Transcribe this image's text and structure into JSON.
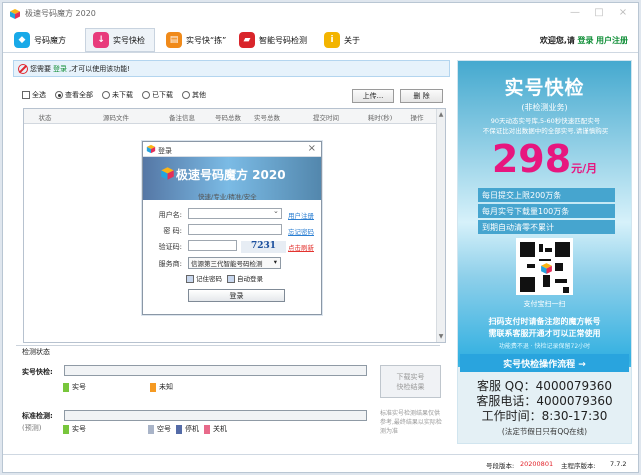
{
  "window": {
    "title": "极速号码魔方 2020",
    "minimize": "—",
    "maximize": "□",
    "close": "×"
  },
  "toolbar": {
    "tabs": [
      {
        "label": "号码魔方",
        "icon": "cube-icon",
        "color": "#18a9e8"
      },
      {
        "label": "实号快检",
        "icon": "download-icon",
        "color": "#e83b7c"
      },
      {
        "label": "实号快“拣”",
        "icon": "clipboard-icon",
        "color": "#f08a1a"
      },
      {
        "label": "智能号码检测",
        "icon": "book-icon",
        "color": "#d9252b"
      },
      {
        "label": "关于",
        "icon": "info-icon",
        "color": "#f3b400"
      }
    ],
    "welcome_prefix": "欢迎您,请",
    "login": "登录",
    "register": "用户注册"
  },
  "notice": {
    "text_prefix": "您需要",
    "text_link": "登录",
    "text_suffix": ",才可以使用该功能!"
  },
  "filters": {
    "select_all": "全选",
    "view_all": "查看全部",
    "not_downloaded": "未下载",
    "downloaded": "已下载",
    "other": "其他",
    "upload": "上传...",
    "delete": "删 除"
  },
  "table": {
    "columns": [
      "状态",
      "源码文件",
      "备注信息",
      "号码总数",
      "实号总数",
      "提交时间",
      "耗时(秒)",
      "操作"
    ]
  },
  "detection": {
    "section_title": "检测状态",
    "quick_label": "实号快检:",
    "legend_real": "实号",
    "legend_unknown": "未知",
    "download_button": "下载实号\n快检结果",
    "standard_label": "标准检测:",
    "standard_sub": "(预测)",
    "legend_empty": "空号",
    "legend_offline": "停机",
    "legend_off": "关机",
    "note": "标准实号检测结果仅供参考,最终结果以实际检测为准"
  },
  "status": {
    "version_label": "号段版本:",
    "version_value": "20200801",
    "program_label": "主程序版本:",
    "program_value": "7.7.2"
  },
  "ad": {
    "title": "实号快检",
    "subtitle": "(非检测业务)",
    "desc": "90天动态实号库,5-60秒快速匹配实号\n不保证比对出数据中的全部实号,请谨慎购买",
    "price": "298",
    "unit": "元/月",
    "features": [
      "每日提交上限200万条",
      "每月实号下载量100万条",
      "到期自动清零不累计"
    ],
    "pay_text": "支付宝扫一扫",
    "scan_text": "扫码支付时请备注您的魔方帐号\n需联系客服开通才可以正常使用",
    "small_text": "功能费不退 · 快检记录保留72小时",
    "flow_button": "实号快检操作流程 →",
    "contact_qq": "客服 QQ：4000079360",
    "contact_phone": "客服电话：4000079360",
    "work_time": "工作时间：8:30-17:30",
    "holiday": "(法定节假日只有QQ在线)"
  },
  "login_dialog": {
    "title": "登录",
    "app_name": "极速号码魔方 2020",
    "tagline": "快速/专业/精准/安全",
    "username_label": "用户名:",
    "password_label": "密 码:",
    "captcha_label": "验证码:",
    "server_label": "服务商:",
    "username_value": "",
    "password_value": "",
    "captcha_value": "",
    "captcha_image": "7231",
    "register_link": "用户注册",
    "forgot_link": "忘记密码",
    "refresh_link": "点击刷新",
    "server_value": "信源第三代智能号码检测",
    "remember_password": "记住密码",
    "auto_login": "自动登录",
    "login_button": "登录"
  }
}
